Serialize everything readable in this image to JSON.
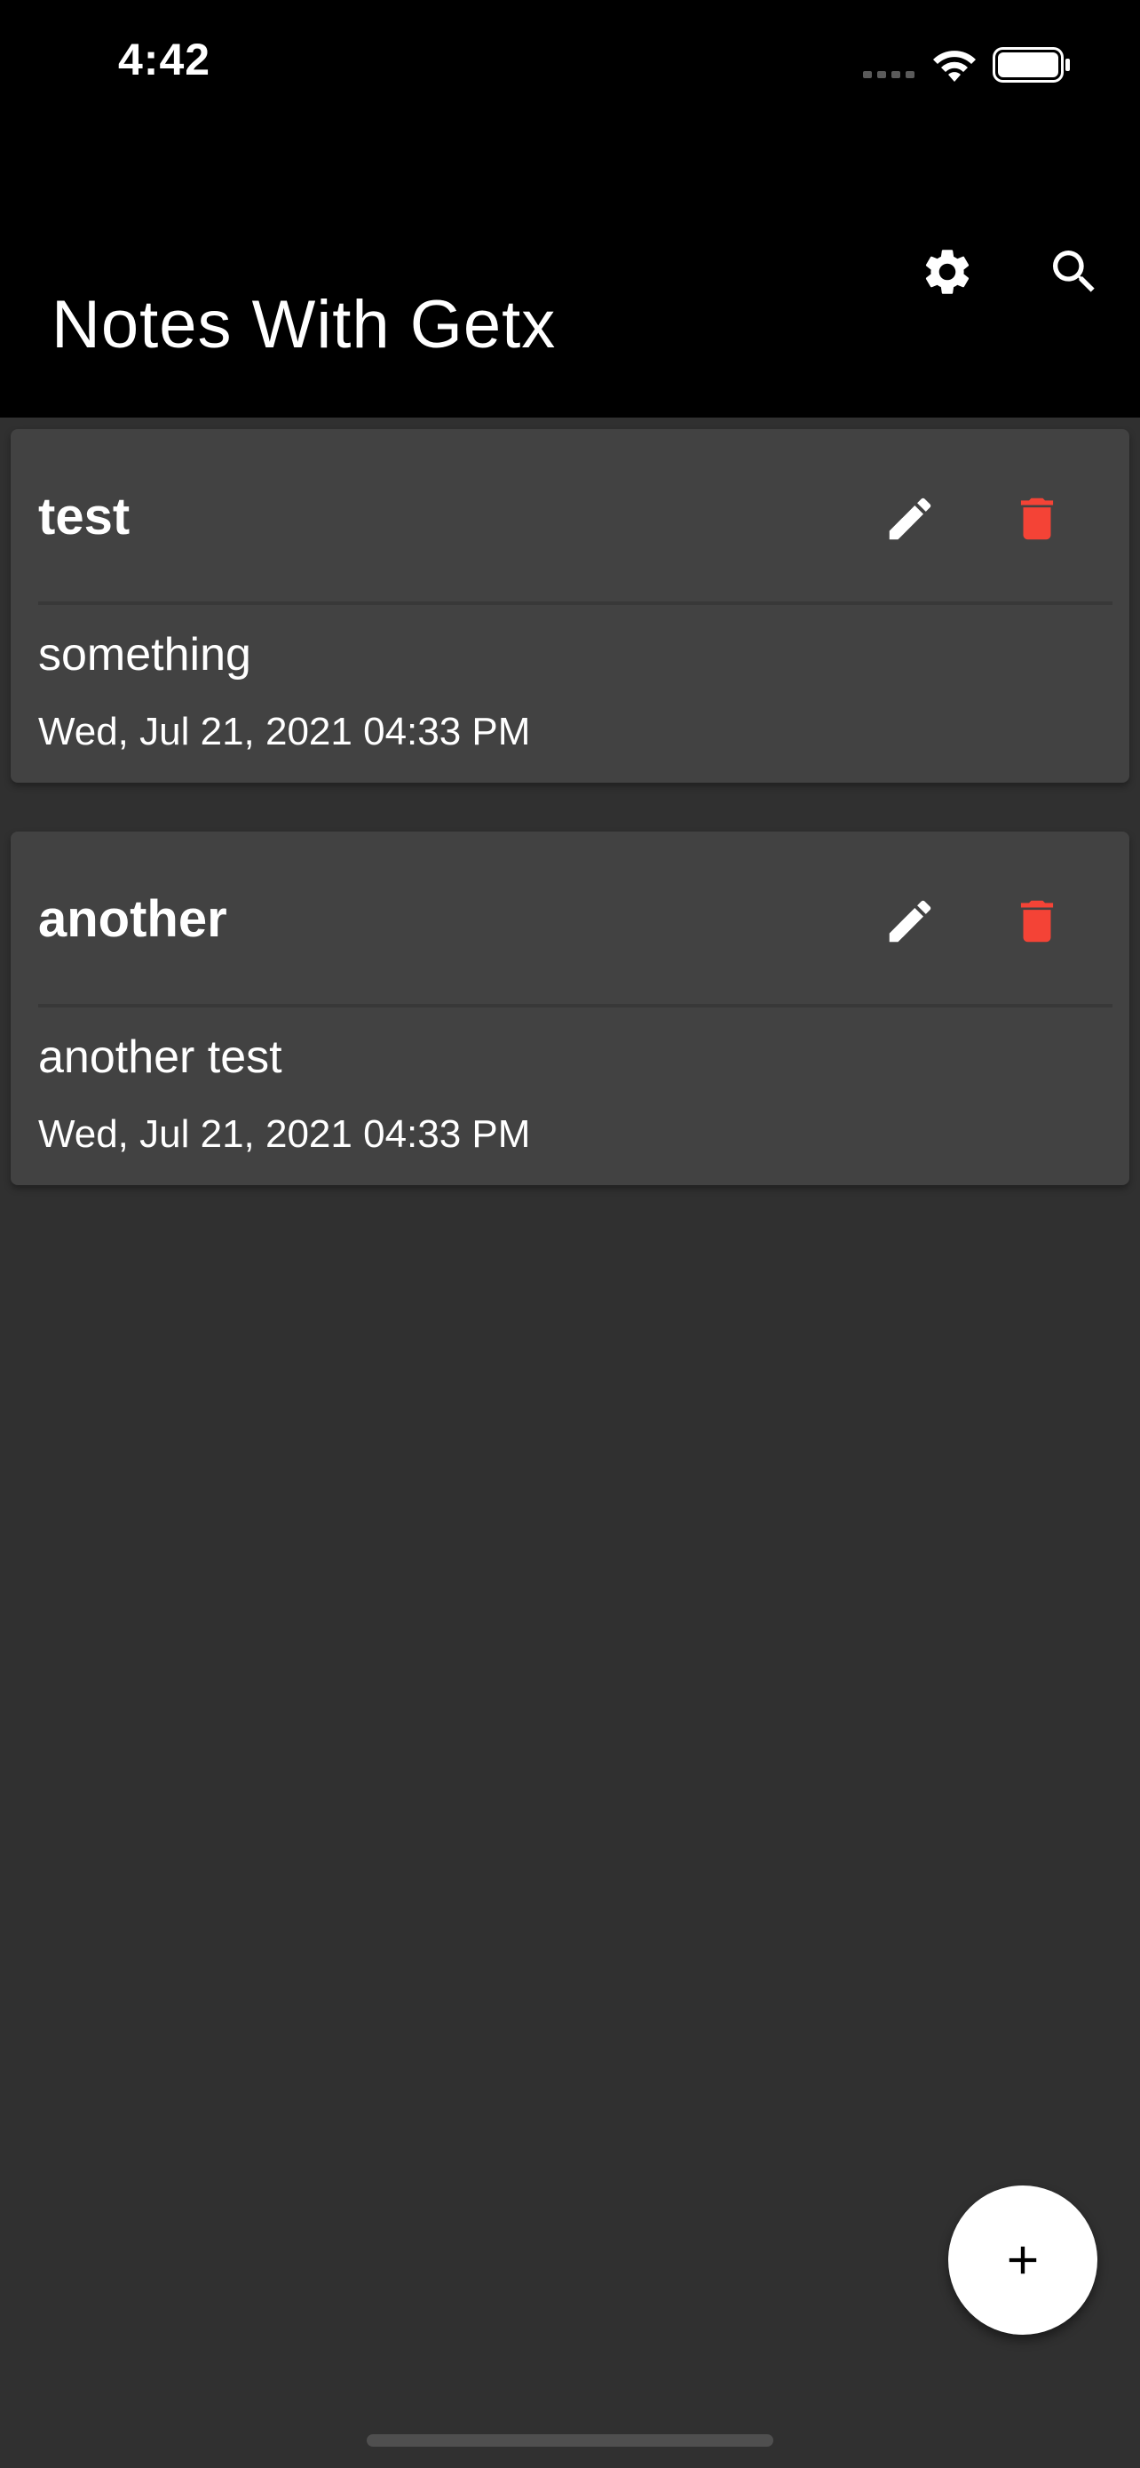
{
  "status_bar": {
    "time": "4:42",
    "icons": [
      "cellular-signal-icon",
      "wifi-icon",
      "battery-icon"
    ]
  },
  "app_bar": {
    "title": "Notes With Getx",
    "actions": [
      {
        "name": "settings",
        "icon": "gear-icon"
      },
      {
        "name": "search",
        "icon": "search-icon"
      }
    ]
  },
  "notes": [
    {
      "title": "test",
      "body": "something",
      "date": "Wed, Jul 21, 2021 04:33 PM"
    },
    {
      "title": "another",
      "body": "another test",
      "date": "Wed, Jul 21, 2021 04:33 PM"
    }
  ],
  "fab": {
    "icon": "plus-icon"
  },
  "colors": {
    "background": "#303030",
    "app_bar": "#000000",
    "card": "#424242",
    "delete": "#f44336",
    "fab": "#ffffff"
  }
}
